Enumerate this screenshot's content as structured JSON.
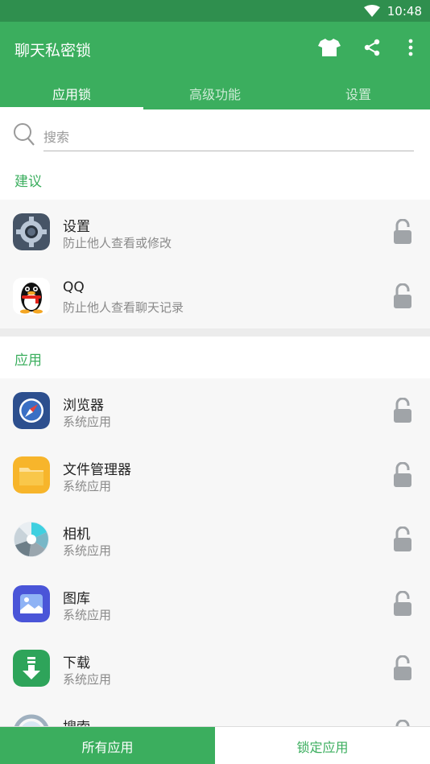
{
  "status_bar": {
    "time": "10:48",
    "wifi_icon": "wifi-icon"
  },
  "app_bar": {
    "title": "聊天私密锁",
    "icons": [
      "tshirt-icon",
      "share-icon",
      "more-vert-icon"
    ]
  },
  "tabs": [
    {
      "label": "应用锁",
      "active": true
    },
    {
      "label": "高级功能",
      "active": false
    },
    {
      "label": "设置",
      "active": false
    }
  ],
  "search": {
    "placeholder": "搜索",
    "value": ""
  },
  "sections": {
    "suggested": {
      "title": "建议",
      "items": [
        {
          "name": "设置",
          "desc": "防止他人查看或修改",
          "icon": "settings-app-icon",
          "locked": false
        },
        {
          "name": "QQ",
          "desc": "防止他人查看聊天记录",
          "icon": "qq-app-icon",
          "locked": false
        }
      ]
    },
    "apps": {
      "title": "应用",
      "items": [
        {
          "name": "浏览器",
          "desc": "系统应用",
          "icon": "browser-app-icon",
          "locked": false
        },
        {
          "name": "文件管理器",
          "desc": "系统应用",
          "icon": "file-manager-app-icon",
          "locked": false
        },
        {
          "name": "相机",
          "desc": "系统应用",
          "icon": "camera-app-icon",
          "locked": false
        },
        {
          "name": "图库",
          "desc": "系统应用",
          "icon": "gallery-app-icon",
          "locked": false
        },
        {
          "name": "下载",
          "desc": "系统应用",
          "icon": "download-app-icon",
          "locked": false
        },
        {
          "name": "搜索",
          "desc": "",
          "icon": "search-app-icon",
          "locked": false
        }
      ]
    }
  },
  "bottom_bar": {
    "all_apps": "所有应用",
    "locked_apps": "锁定应用"
  },
  "colors": {
    "primary": "#3bae5e",
    "status_bar": "#2f8f4e",
    "lock_gray": "#a0a4a8"
  }
}
